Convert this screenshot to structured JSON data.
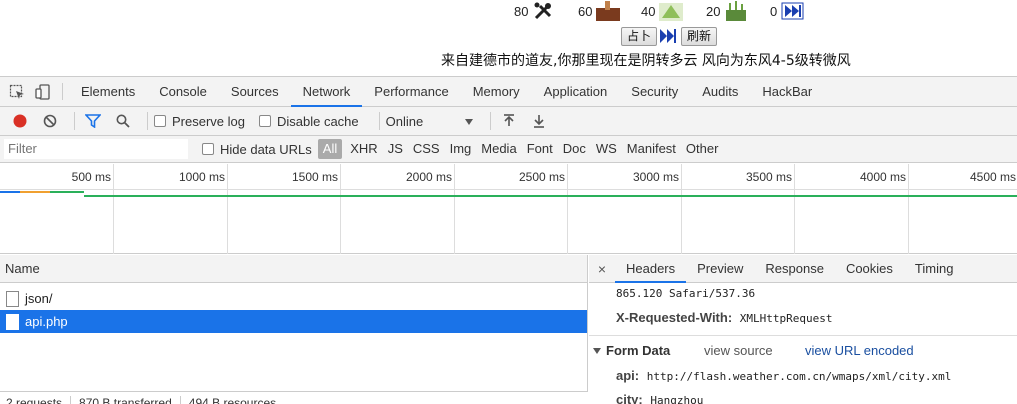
{
  "page": {
    "stats": [
      {
        "value": "80",
        "icon": "tools-icon"
      },
      {
        "value": "60",
        "icon": "brown-item-icon"
      },
      {
        "value": "40",
        "icon": "green-item-icon"
      },
      {
        "value": "20",
        "icon": "plant-icon"
      },
      {
        "value": "0",
        "icon": "fast-forward-icon"
      }
    ],
    "divine_button": "占卜",
    "refresh_button": "刷新",
    "weather_text": "来自建德市的道友,你那里现在是阴转多云 风向为东风4-5级转微风"
  },
  "devtools": {
    "tabs": [
      "Elements",
      "Console",
      "Sources",
      "Network",
      "Performance",
      "Memory",
      "Application",
      "Security",
      "Audits",
      "HackBar"
    ],
    "active_tab": "Network",
    "toolbar": {
      "preserve_log": "Preserve log",
      "disable_cache": "Disable cache",
      "throttle": "Online"
    },
    "filter": {
      "placeholder": "Filter",
      "hide_data_urls": "Hide data URLs",
      "types": [
        "All",
        "XHR",
        "JS",
        "CSS",
        "Img",
        "Media",
        "Font",
        "Doc",
        "WS",
        "Manifest",
        "Other"
      ]
    },
    "timeline": {
      "ticks": [
        "500 ms",
        "1000 ms",
        "1500 ms",
        "2000 ms",
        "2500 ms",
        "3000 ms",
        "3500 ms",
        "4000 ms",
        "4500 ms"
      ]
    },
    "requests": {
      "header": "Name",
      "rows": [
        {
          "name": "json/",
          "selected": false
        },
        {
          "name": "api.php",
          "selected": true
        }
      ],
      "status": [
        "2 requests",
        "870 B transferred",
        "494 B resources"
      ]
    },
    "detail": {
      "tabs": [
        "Headers",
        "Preview",
        "Response",
        "Cookies",
        "Timing"
      ],
      "active_tab": "Headers",
      "close": "×",
      "ua_tail": "865.120 Safari/537.36",
      "xrw_key": "X-Requested-With:",
      "xrw_value": "XMLHttpRequest",
      "form_data_title": "Form Data",
      "view_source": "view source",
      "view_url_encoded": "view URL encoded",
      "form_fields": [
        {
          "key": "api:",
          "value": "http://flash.weather.com.cn/wmaps/xml/city.xml"
        },
        {
          "key": "city:",
          "value": "Hangzhou"
        }
      ]
    }
  },
  "colors": {
    "accent": "#1a73e8",
    "record": "#d93025",
    "link": "#1a4fa0"
  }
}
